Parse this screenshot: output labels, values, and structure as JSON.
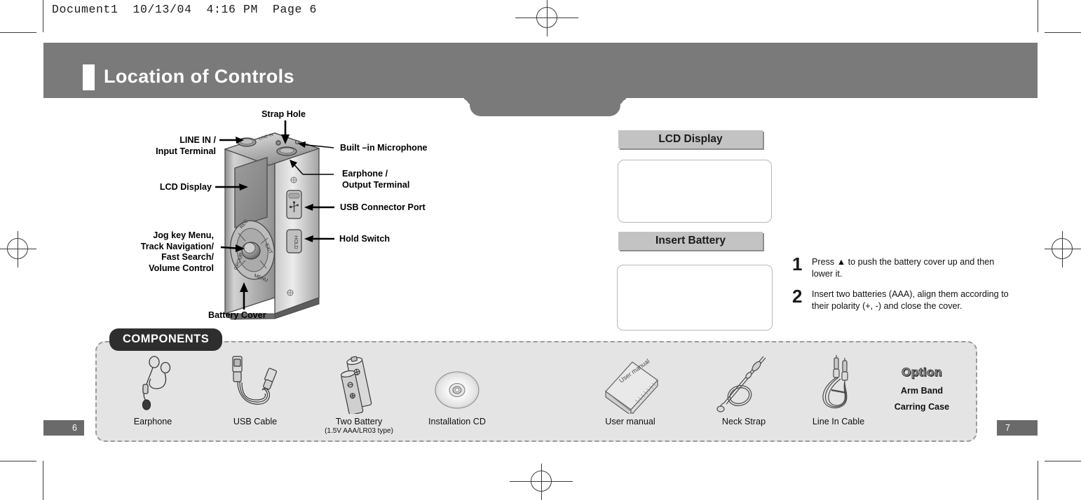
{
  "doc_header": "Document1  10/13/04  4:16 PM  Page 6",
  "title": {
    "heading": "Location of Controls"
  },
  "diagram": {
    "labels_left": [
      {
        "text": "LINE IN /\nInput Terminal"
      },
      {
        "text": "LCD Display"
      },
      {
        "text": "Jog key Menu,\nTrack Navigation/\nFast Search/\nVolume Control"
      }
    ],
    "label_top": "Strap Hole",
    "label_bottom": "Battery Cover",
    "labels_right": [
      {
        "text": "Built –in Microphone"
      },
      {
        "text": "Earphone /\nOutput Terminal"
      },
      {
        "text": "USB Connector Port"
      },
      {
        "text": "Hold Switch"
      }
    ],
    "jog_ring": [
      "REC",
      "EXIT",
      "MENU",
      "GROUP"
    ]
  },
  "panel": {
    "lcd_header": "LCD Display",
    "battery_header": "Insert Battery",
    "steps": [
      {
        "num": "1",
        "text": "Press ▲ to push the battery cover up and then lower it."
      },
      {
        "num": "2",
        "text": "Insert two batteries (AAA), align them according to their polarity (+, -) and close the cover."
      }
    ]
  },
  "components": {
    "badge": "COMPONENTS",
    "items": [
      {
        "label": "Earphone",
        "sub": ""
      },
      {
        "label": "USB Cable",
        "sub": ""
      },
      {
        "label": "Two Battery",
        "sub": "(1.5V AAA/LR03 type)"
      },
      {
        "label": "Installation CD",
        "sub": ""
      },
      {
        "label": "User manual",
        "sub": "",
        "art_text": "User manual"
      },
      {
        "label": "Neck Strap",
        "sub": ""
      },
      {
        "label": "Line In Cable",
        "sub": ""
      }
    ],
    "option": {
      "title": "Option",
      "lines": [
        "Arm Band",
        "Carring Case"
      ]
    }
  },
  "page_numbers": {
    "left": "6",
    "right": "7"
  },
  "colors": {
    "header_gray": "#7a7a7a",
    "section_header_gray": "#c3c3c3",
    "components_bg": "#e4e4e4",
    "badge_dark": "#2e2e2e",
    "pagenum_gray": "#6a6a6a"
  }
}
